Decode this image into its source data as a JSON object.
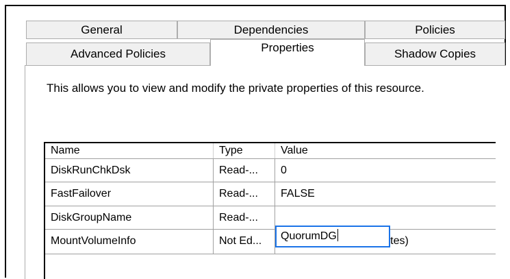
{
  "tabs_row1": [
    {
      "label": "General"
    },
    {
      "label": "Dependencies"
    },
    {
      "label": "Policies"
    }
  ],
  "tabs_row2": [
    {
      "label": "Advanced Policies"
    },
    {
      "label": "Properties",
      "active": true
    },
    {
      "label": "Shadow Copies"
    }
  ],
  "description": "This allows you to view and modify the private properties of this resource.",
  "grid": {
    "headers": {
      "name": "Name",
      "type": "Type",
      "value": "Value"
    },
    "rows": [
      {
        "name": "DiskRunChkDsk",
        "type": "Read-...",
        "value": "0"
      },
      {
        "name": "FastFailover",
        "type": "Read-...",
        "value": "FALSE"
      },
      {
        "name": "DiskGroupName",
        "type": "Read-...",
        "value": "QuorumDG"
      },
      {
        "name": "MountVolumeInfo",
        "type": "Not Ed...",
        "value": "00 00 00 00 ... (200 bytes)"
      }
    ]
  },
  "colors": {
    "edit_focus_border": "#1a73e8",
    "tab_bg": "#f0f0f0"
  }
}
